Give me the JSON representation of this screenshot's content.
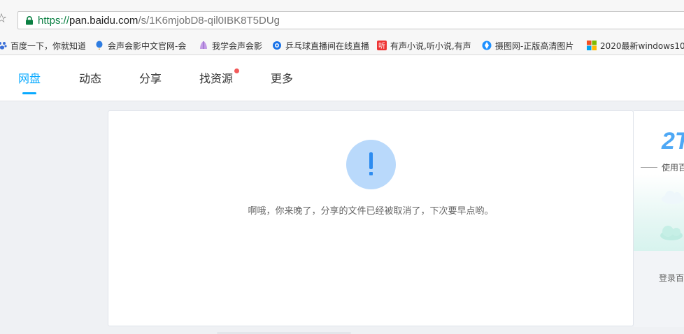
{
  "browser": {
    "url_scheme": "https://",
    "url_host": "pan.baidu.com",
    "url_path": "/s/1K6mjobD8-qil0IBK8T5DUg",
    "bookmarks": [
      {
        "label": "百度一下，你就知道",
        "icon": "baidu-paw-icon",
        "color": "#3b6fd8"
      },
      {
        "label": "会声会影中文官网-会",
        "icon": "balloon-icon",
        "color": "#2f7de1"
      },
      {
        "label": "我学会声会影",
        "icon": "shell-icon",
        "color": "#b76ad8"
      },
      {
        "label": "乒乓球直播间在线直播",
        "icon": "ball-icon",
        "color": "#1a73e8"
      },
      {
        "label": "有声小说,听小说,有声",
        "icon": "ting-icon",
        "color": "#e33"
      },
      {
        "label": "摄图网-正版高清图片",
        "icon": "camera-icon",
        "color": "#1e90ff"
      },
      {
        "label": "2020最新windows10",
        "icon": "windows-icon",
        "color": "#f25022"
      }
    ]
  },
  "nav": {
    "items": [
      {
        "label": "网盘",
        "active": true
      },
      {
        "label": "动态",
        "active": false
      },
      {
        "label": "分享",
        "active": false
      },
      {
        "label": "找资源",
        "active": false,
        "badge": true
      },
      {
        "label": "更多",
        "active": false
      }
    ],
    "active_color": "#09aaff"
  },
  "main": {
    "icon": "exclamation-circle-icon",
    "message": "啊哦，你来晚了，分享的文件已经被取消了，下次要早点哟。"
  },
  "side": {
    "big_number": "2T",
    "use_text": "使用百",
    "login_text": "登录百"
  }
}
